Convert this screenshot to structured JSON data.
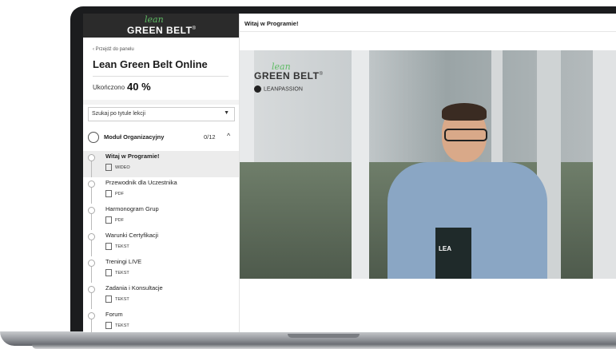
{
  "sidebar": {
    "brand_script": "lean",
    "brand_name": "GREEN BELT",
    "brand_mark": "®",
    "back_link": "‹ Przejdź do panelu",
    "course_title": "Lean Green Belt Online",
    "progress_label": "Ukończono",
    "progress_value": "40 %",
    "progress_fraction": 0.4,
    "search_placeholder": "Szukaj po tytule lekcji",
    "module": {
      "name": "Moduł Organizacyjny",
      "count": "0/12"
    },
    "lessons": [
      {
        "title": "Witaj w Programie!",
        "type": "WIDEO",
        "active": true
      },
      {
        "title": "Przewodnik dla Uczestnika",
        "type": "PDF",
        "active": false
      },
      {
        "title": "Harmonogram Grup",
        "type": "PDF",
        "active": false
      },
      {
        "title": "Warunki Certyfikacji",
        "type": "TEKST",
        "active": false
      },
      {
        "title": "Treningi LIVE",
        "type": "TEKST",
        "active": false
      },
      {
        "title": "Zadania i Konsultacje",
        "type": "TEKST",
        "active": false
      },
      {
        "title": "Forum",
        "type": "TEKST",
        "active": false
      }
    ]
  },
  "main": {
    "title": "Witaj w Programie!",
    "video": {
      "logo_script": "lean",
      "logo_name": "GREEN BELT",
      "logo_mark": "®",
      "partner": "LEANPASSION",
      "book_text": "LEA"
    }
  },
  "colors": {
    "accent_green": "#5dbb63",
    "brand_bar": "#2b2b2b"
  }
}
